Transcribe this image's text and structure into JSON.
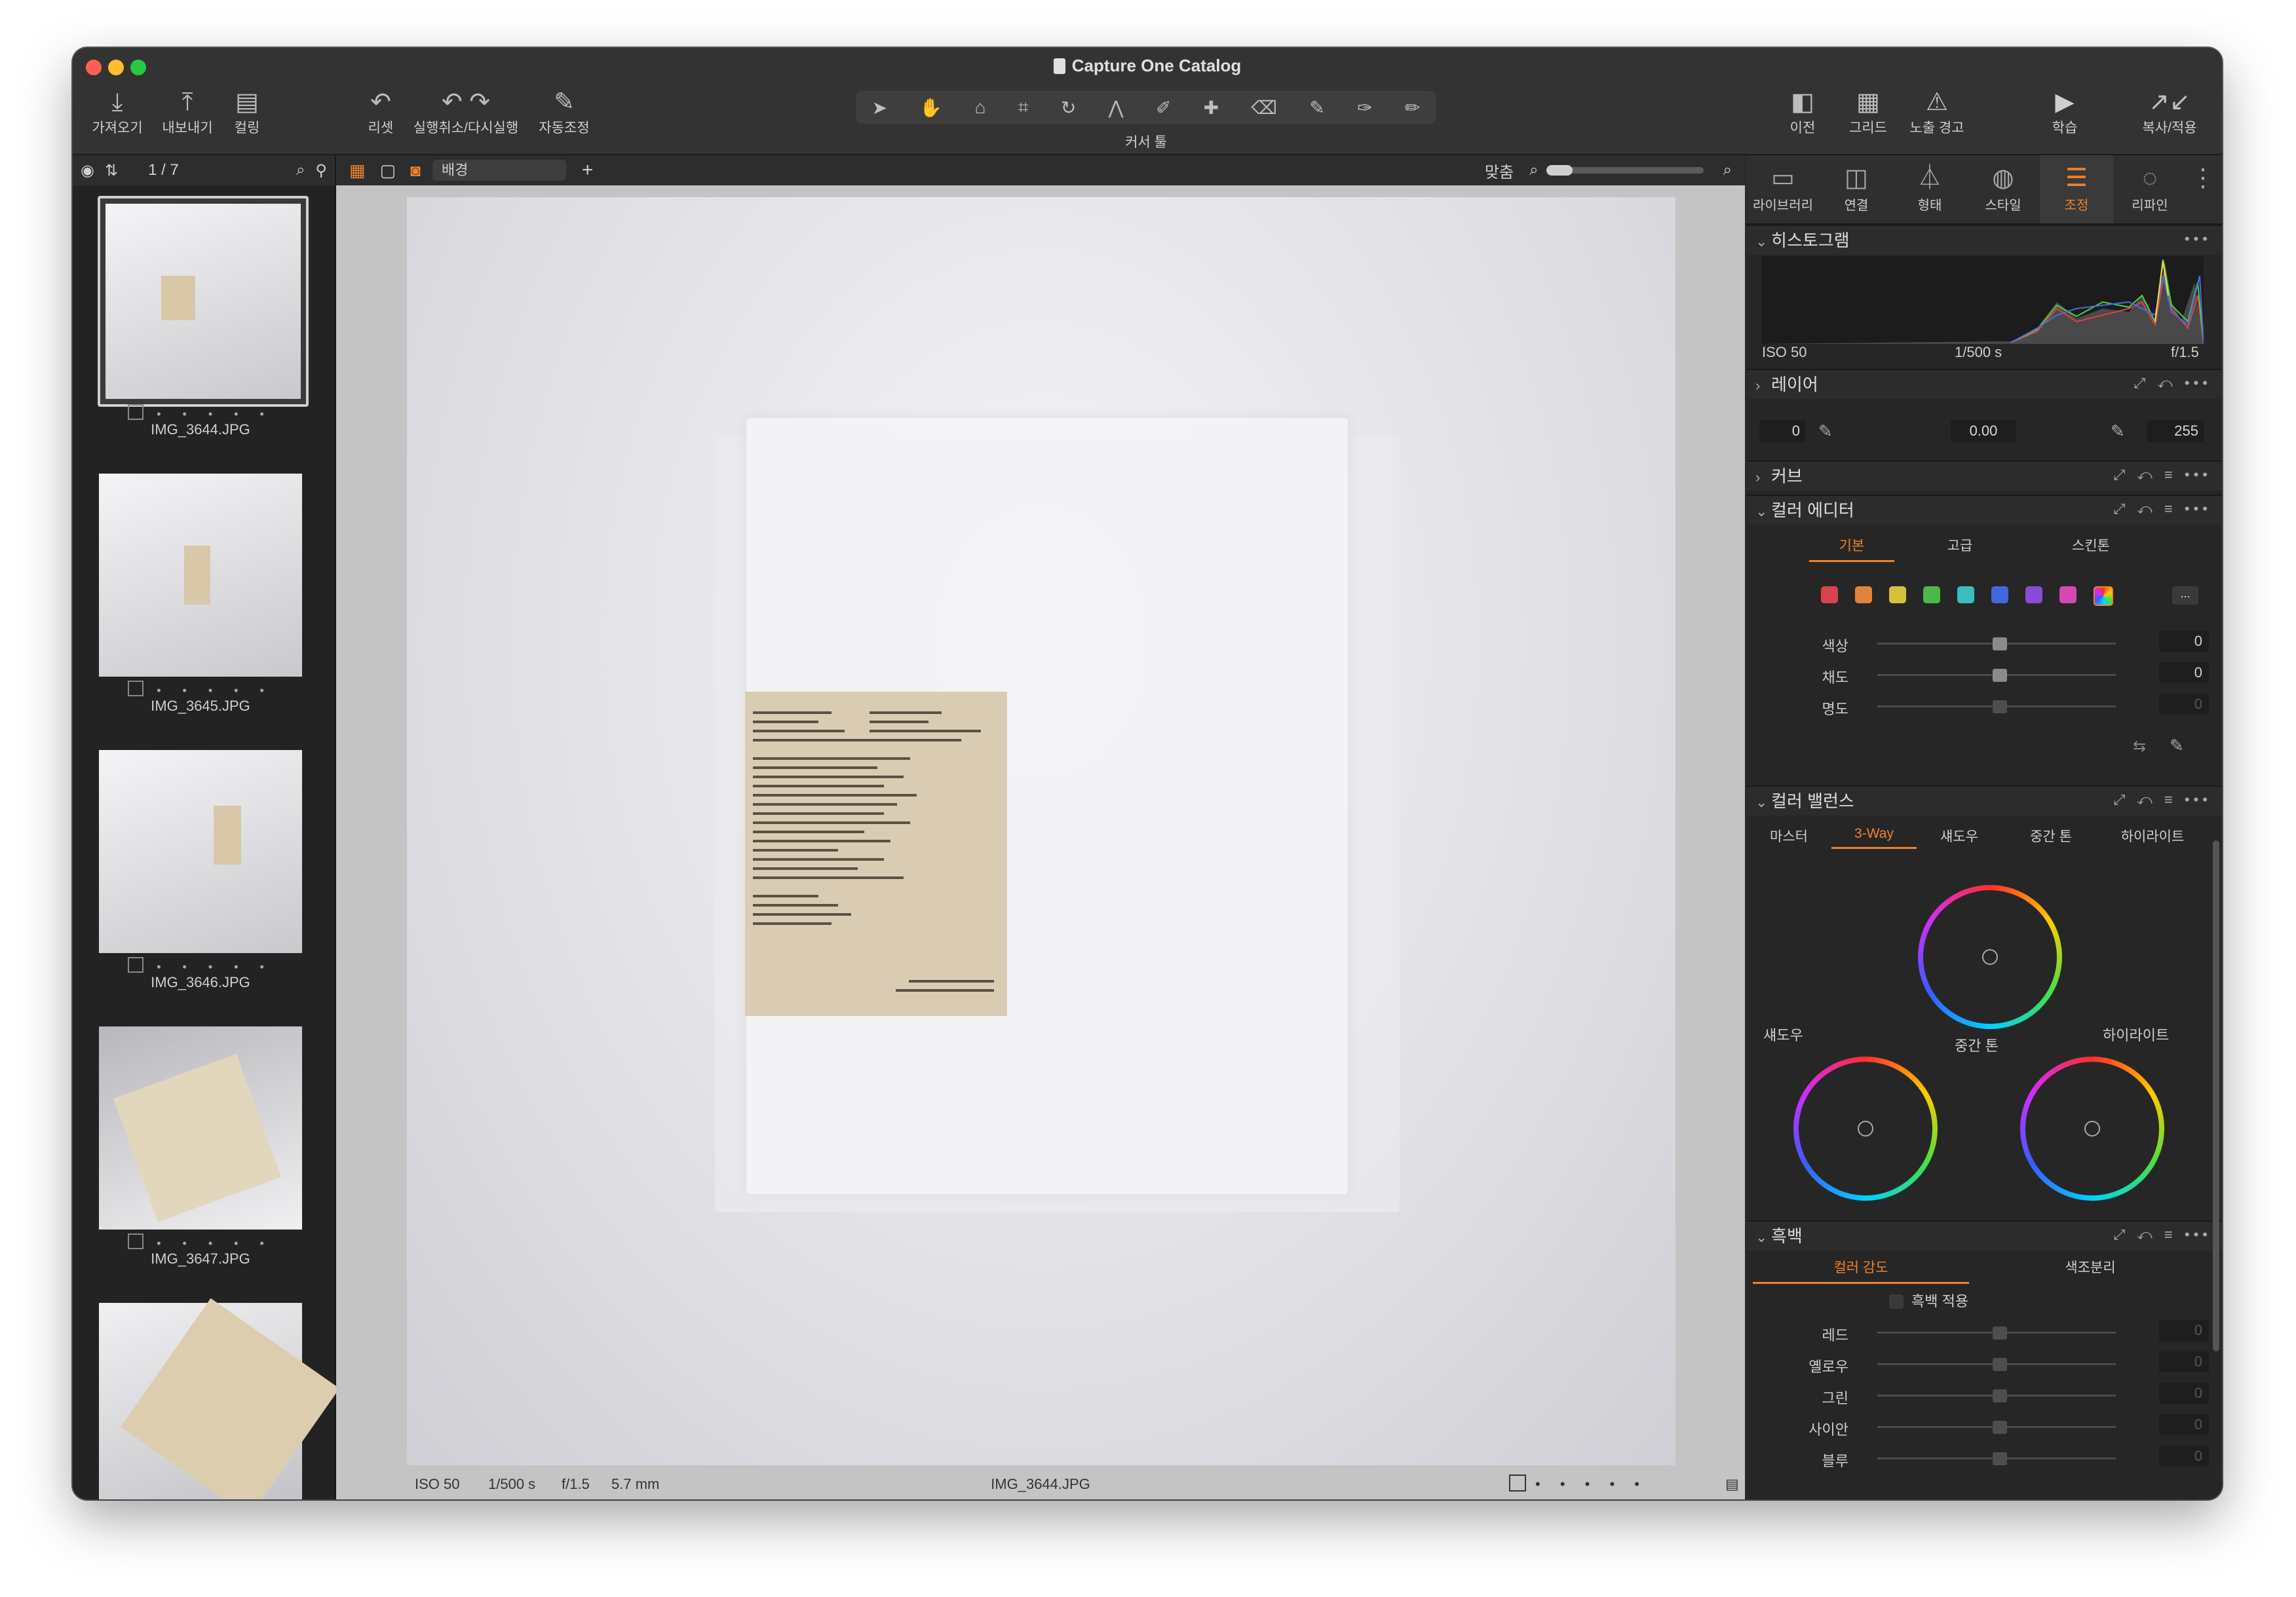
{
  "window": {
    "title": "Capture One Catalog"
  },
  "toolbar": {
    "import": "가져오기",
    "export": "내보내기",
    "cull": "컬링",
    "reset": "리셋",
    "undo_redo": "실행취소/다시실행",
    "auto_adjust": "자동조정",
    "cursor_tools": "커서 툴",
    "before": "이전",
    "grid": "그리드",
    "exposure_warning": "노출 경고",
    "learn": "학습",
    "copy_apply": "복사/적용"
  },
  "browser": {
    "counter": "1 / 7",
    "thumbnails": [
      {
        "filename": "IMG_3644.JPG",
        "rating_dots": "• • • • •"
      },
      {
        "filename": "IMG_3645.JPG",
        "rating_dots": "• • • • •"
      },
      {
        "filename": "IMG_3646.JPG",
        "rating_dots": "• • • • •"
      },
      {
        "filename": "IMG_3647.JPG",
        "rating_dots": "• • • • •"
      }
    ]
  },
  "viewer": {
    "background_select": "배경",
    "fit_label": "맞춤",
    "footer": {
      "iso": "ISO 50",
      "shutter": "1/500 s",
      "aperture": "f/1.5",
      "focal": "5.7 mm",
      "filename": "IMG_3644.JPG",
      "rating_dots": "• • • • •"
    }
  },
  "panel": {
    "tabs": [
      "라이브러리",
      "연결",
      "형태",
      "스타일",
      "조정",
      "리파인"
    ],
    "active_tab": "조정",
    "histogram": {
      "title": "히스토그램",
      "iso": "ISO 50",
      "shutter": "1/500 s",
      "aperture": "f/1.5"
    },
    "layers": {
      "title": "레이어",
      "levels_low": "0",
      "levels_mid": "0.00",
      "levels_high": "255"
    },
    "curve": {
      "title": "커브"
    },
    "color_editor": {
      "title": "컬러 에디터",
      "tabs": [
        "기본",
        "고급",
        "스킨톤"
      ],
      "swatches": [
        "#d9434b",
        "#e0843a",
        "#d6c13a",
        "#4cb84a",
        "#3bbdbd",
        "#4466dd",
        "#8a4bd6",
        "#d04ab0"
      ],
      "more": "...",
      "sliders": [
        {
          "name": "색상",
          "value": "0"
        },
        {
          "name": "채도",
          "value": "0"
        },
        {
          "name": "명도",
          "value": "0"
        }
      ]
    },
    "color_balance": {
      "title": "컬러 밸런스",
      "tabs": [
        "마스터",
        "3-Way",
        "섀도우",
        "중간 톤",
        "하이라이트"
      ],
      "wheel_labels": {
        "shadow": "섀도우",
        "midtone": "중간 톤",
        "highlight": "하이라이트"
      }
    },
    "bw": {
      "title": "흑백",
      "tabs": [
        "컬러 감도",
        "색조분리"
      ],
      "apply_label": "흑백 적용",
      "sliders": [
        {
          "name": "레드",
          "value": "0"
        },
        {
          "name": "옐로우",
          "value": "0"
        },
        {
          "name": "그린",
          "value": "0"
        },
        {
          "name": "사이안",
          "value": "0"
        },
        {
          "name": "블루",
          "value": "0"
        }
      ]
    }
  },
  "colors": {
    "accent": "#f0822a",
    "window_bg": "#2a2a2a",
    "panel_bg": "#262626"
  }
}
